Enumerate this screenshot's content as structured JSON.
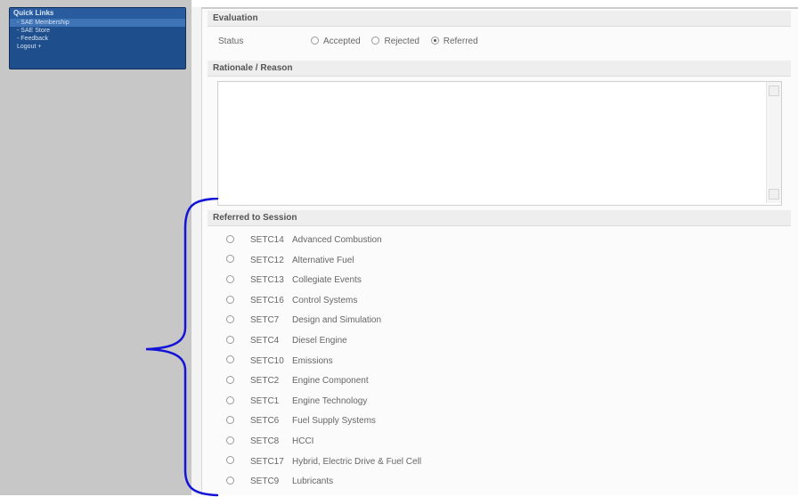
{
  "quick_links": {
    "title": "Quick Links",
    "items": [
      {
        "label": "- SAE Membership",
        "highlight": true
      },
      {
        "label": "- SAE Store",
        "highlight": false
      },
      {
        "label": "- Feedback",
        "highlight": false
      },
      {
        "label": "Logout +",
        "highlight": false
      }
    ]
  },
  "evaluation": {
    "title": "Evaluation",
    "status_label": "Status",
    "options": [
      {
        "label": "Accepted",
        "checked": false
      },
      {
        "label": "Rejected",
        "checked": false
      },
      {
        "label": "Referred",
        "checked": true
      }
    ]
  },
  "rationale": {
    "title": "Rationale / Reason",
    "value": ""
  },
  "referred": {
    "title": "Referred to Session",
    "sessions": [
      {
        "code": "SETC14",
        "name": "Advanced Combustion"
      },
      {
        "code": "SETC12",
        "name": "Alternative Fuel"
      },
      {
        "code": "SETC13",
        "name": "Collegiate Events"
      },
      {
        "code": "SETC16",
        "name": "Control Systems"
      },
      {
        "code": "SETC7",
        "name": "Design and Simulation"
      },
      {
        "code": "SETC4",
        "name": "Diesel Engine"
      },
      {
        "code": "SETC10",
        "name": "Emissions"
      },
      {
        "code": "SETC2",
        "name": "Engine Component"
      },
      {
        "code": "SETC1",
        "name": "Engine Technology"
      },
      {
        "code": "SETC6",
        "name": "Fuel Supply Systems"
      },
      {
        "code": "SETC8",
        "name": "HCCI"
      },
      {
        "code": "SETC17",
        "name": "Hybrid, Electric Drive & Fuel Cell"
      },
      {
        "code": "SETC9",
        "name": "Lubricants"
      }
    ]
  },
  "colors": {
    "annotation_bracket": "#1414d8",
    "quick_links_bg": "#1e4f8c"
  }
}
